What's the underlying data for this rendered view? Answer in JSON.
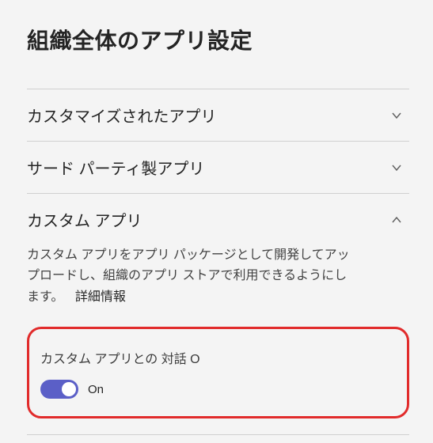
{
  "page": {
    "title": "組織全体のアプリ設定"
  },
  "sections": [
    {
      "title": "カスタマイズされたアプリ",
      "expanded": false
    },
    {
      "title": "サード パーティ製アプリ",
      "expanded": false
    },
    {
      "title": "カスタム アプリ",
      "expanded": true,
      "description": "カスタム アプリをアプリ パッケージとして開発してアップロードし、組織のアプリ ストアで利用できるようにします。",
      "more_info_label": "詳細情報",
      "toggle": {
        "label": "カスタム アプリとの 対話 O",
        "state_label": "On",
        "on": true
      }
    }
  ]
}
